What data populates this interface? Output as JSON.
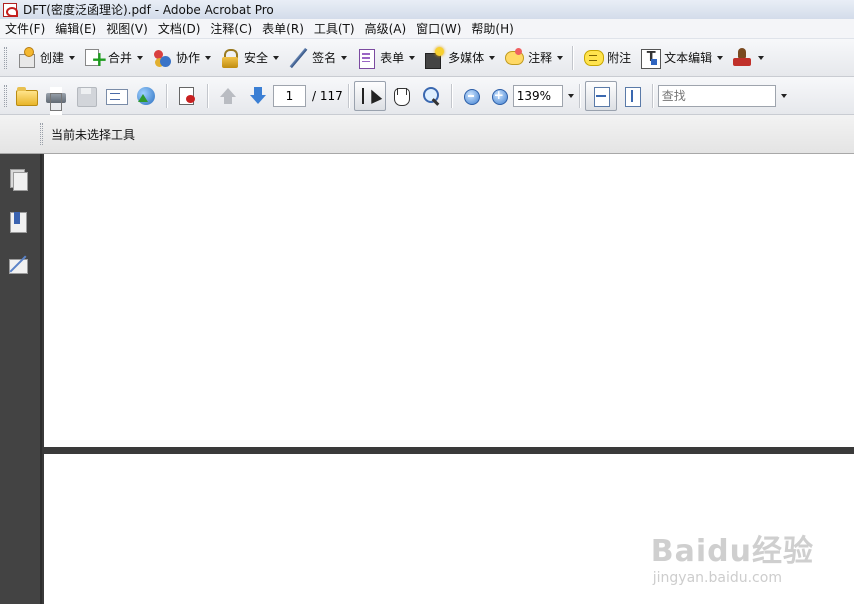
{
  "window": {
    "title": "DFT(密度泛函理论).pdf - Adobe Acrobat Pro"
  },
  "menubar": [
    {
      "label": "文件(F)"
    },
    {
      "label": "编辑(E)"
    },
    {
      "label": "视图(V)"
    },
    {
      "label": "文档(D)"
    },
    {
      "label": "注释(C)"
    },
    {
      "label": "表单(R)"
    },
    {
      "label": "工具(T)"
    },
    {
      "label": "高级(A)"
    },
    {
      "label": "窗口(W)"
    },
    {
      "label": "帮助(H)"
    }
  ],
  "tasks_toolbar": {
    "create": {
      "label": "创建",
      "icon": "create-icon"
    },
    "combine": {
      "label": "合并",
      "icon": "combine-icon"
    },
    "collaborate": {
      "label": "协作",
      "icon": "collaborate-icon"
    },
    "secure": {
      "label": "安全",
      "icon": "lock-icon"
    },
    "sign": {
      "label": "签名",
      "icon": "pen-icon"
    },
    "forms": {
      "label": "表单",
      "icon": "form-icon"
    },
    "multimedia": {
      "label": "多媒体",
      "icon": "multimedia-icon"
    },
    "comment": {
      "label": "注释",
      "icon": "comment-icon"
    },
    "sticky_note": {
      "label": "附注",
      "icon": "sticky-note-icon"
    },
    "text_edit": {
      "label": "文本编辑",
      "icon": "text-edit-icon"
    },
    "stamp": {
      "icon": "stamp-icon"
    }
  },
  "nav_toolbar": {
    "page_number": "1",
    "page_total": "/ 117",
    "zoom": "139%",
    "search_placeholder": "查找"
  },
  "properties_bar": {
    "hint": "当前未选择工具"
  },
  "watermark": {
    "logo": "Baidu经验",
    "url": "jingyan.baidu.com"
  }
}
